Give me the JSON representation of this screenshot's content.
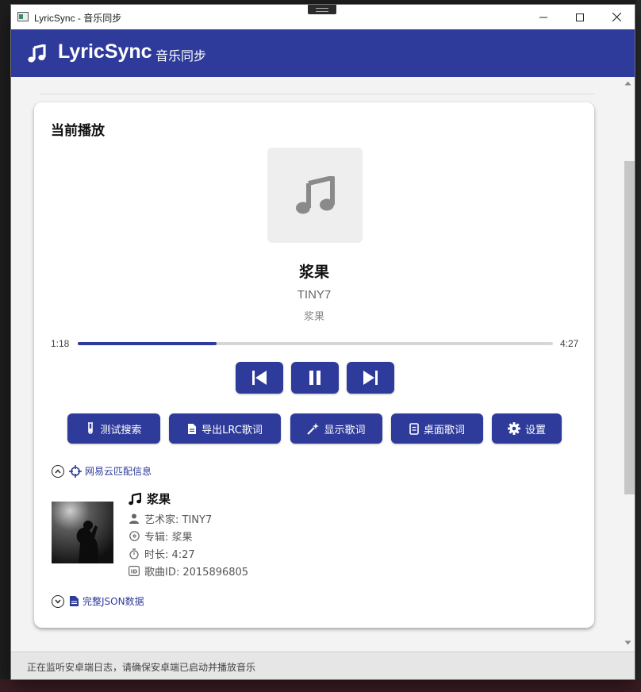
{
  "window": {
    "title": "LyricSync - 音乐同步"
  },
  "header": {
    "title": "LyricSync",
    "subtitle": "音乐同步"
  },
  "now_playing": {
    "section_title": "当前播放",
    "song": "浆果",
    "artist": "TINY7",
    "album": "浆果",
    "current_time": "1:18",
    "total_time": "4:27",
    "progress_fraction": 0.2921
  },
  "controls": {
    "previous_icon": "skip-previous-icon",
    "pause_icon": "pause-icon",
    "next_icon": "skip-next-icon"
  },
  "actions": [
    {
      "label": "测试搜索",
      "icon": "test-tube-icon"
    },
    {
      "label": "导出LRC歌词",
      "icon": "file-icon"
    },
    {
      "label": "显示歌词",
      "icon": "magic-wand-icon"
    },
    {
      "label": "桌面歌词",
      "icon": "notebook-icon"
    },
    {
      "label": "设置",
      "icon": "gear-icon"
    }
  ],
  "match_info": {
    "toggle_label": "网易云匹配信息",
    "song": "浆果",
    "artist_line": "艺术家: TINY7",
    "album_line": "专辑: 浆果",
    "duration_line": "时长: 4:27",
    "id_line": "歌曲ID: 2015896805"
  },
  "json_section": {
    "toggle_label": "完整JSON数据"
  },
  "status": {
    "text": "正在监听安卓端日志，请确保安卓端已启动并播放音乐"
  },
  "colors": {
    "accent": "#2e3b9a",
    "header_bg": "#2e3b9a",
    "card_bg": "#ffffff",
    "window_bg": "#f3f3f3"
  }
}
